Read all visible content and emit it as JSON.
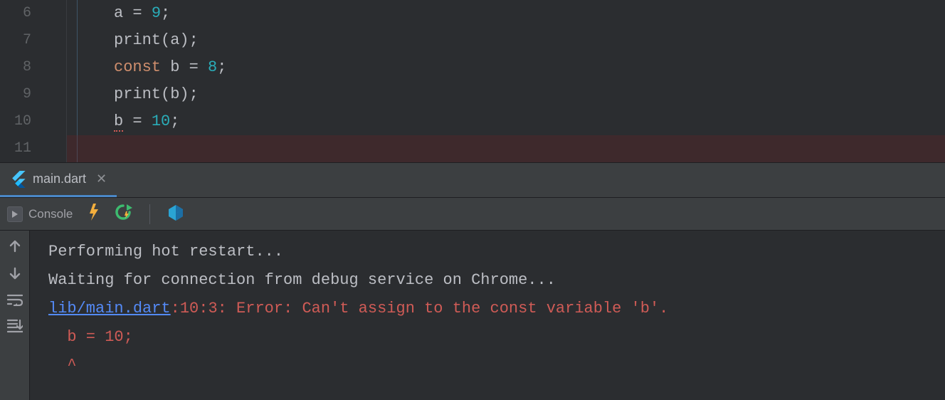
{
  "editor": {
    "lines": [
      {
        "num": "6",
        "tokens": [
          [
            "id",
            "a"
          ],
          [
            "sp",
            " "
          ],
          [
            "op",
            "="
          ],
          [
            "sp",
            " "
          ],
          [
            "num",
            "9"
          ],
          [
            "punc",
            ";"
          ]
        ]
      },
      {
        "num": "7",
        "tokens": [
          [
            "fn",
            "print"
          ],
          [
            "punc",
            "("
          ],
          [
            "id",
            "a"
          ],
          [
            "punc",
            ")"
          ],
          [
            "punc",
            ";"
          ]
        ]
      },
      {
        "num": "8",
        "tokens": [
          [
            "kw",
            "const"
          ],
          [
            "sp",
            " "
          ],
          [
            "id",
            "b"
          ],
          [
            "sp",
            " "
          ],
          [
            "op",
            "="
          ],
          [
            "sp",
            " "
          ],
          [
            "num",
            "8"
          ],
          [
            "punc",
            ";"
          ]
        ]
      },
      {
        "num": "9",
        "tokens": [
          [
            "fn",
            "print"
          ],
          [
            "punc",
            "("
          ],
          [
            "id",
            "b"
          ],
          [
            "punc",
            ")"
          ],
          [
            "punc",
            ";"
          ]
        ]
      },
      {
        "num": "10",
        "tokens": [
          [
            "err",
            "b"
          ],
          [
            "sp",
            " "
          ],
          [
            "op",
            "="
          ],
          [
            "sp",
            " "
          ],
          [
            "num",
            "10"
          ],
          [
            "punc",
            ";"
          ]
        ]
      },
      {
        "num": "11",
        "breakpoint": true,
        "tokens": []
      }
    ]
  },
  "tab": {
    "filename": "main.dart"
  },
  "toolbar": {
    "console_label": "Console"
  },
  "console": {
    "lines": [
      [
        [
          "normal",
          "Performing hot restart..."
        ]
      ],
      [
        [
          "normal",
          "Waiting for connection from debug service on Chrome..."
        ]
      ],
      [
        [
          "link",
          "lib/main.dart"
        ],
        [
          "err",
          ":10:3: Error: Can't assign to the const variable 'b'."
        ]
      ],
      [
        [
          "err",
          "  b = 10;"
        ]
      ],
      [
        [
          "err",
          "  ^"
        ]
      ]
    ]
  }
}
